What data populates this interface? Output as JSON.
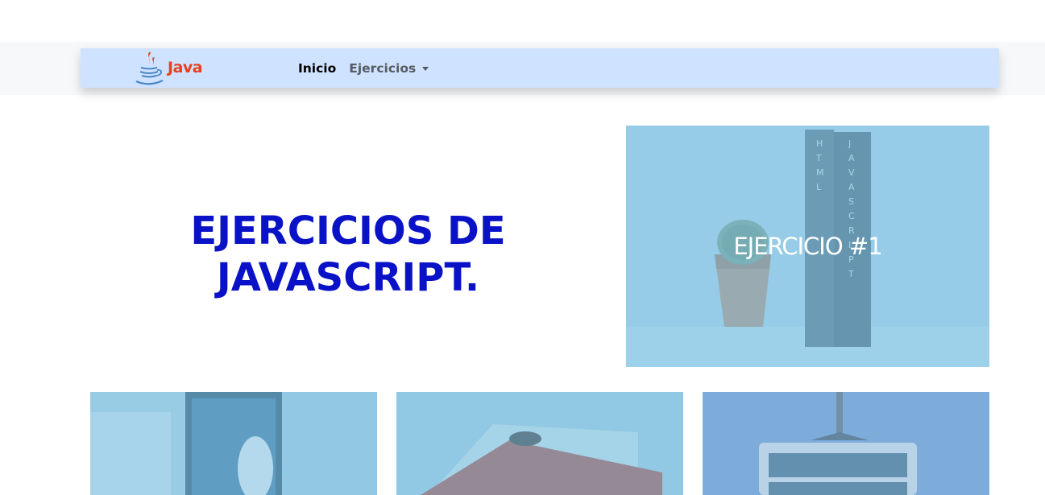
{
  "navbar": {
    "brand_text": "Java",
    "links": [
      {
        "label": "Inicio",
        "active": true
      },
      {
        "label": "Ejercicios",
        "dropdown": true
      }
    ],
    "background": "#cfe2ff",
    "brand_color": "#e8401c"
  },
  "hero": {
    "title_line1": "EJERCICIOS DE",
    "title_line2": "JAVASCRIPT.",
    "color": "#0a12c8"
  },
  "cards": [
    {
      "caption": "EJERCICIO #1",
      "image": "books-and-cactus-photo"
    },
    {
      "caption": "",
      "image": "desk-with-monitor-photo"
    },
    {
      "caption": "",
      "image": "red-book-photo"
    },
    {
      "caption": "",
      "image": "lamp-and-desk-photo"
    }
  ],
  "overlay_color": "#87c4e3"
}
